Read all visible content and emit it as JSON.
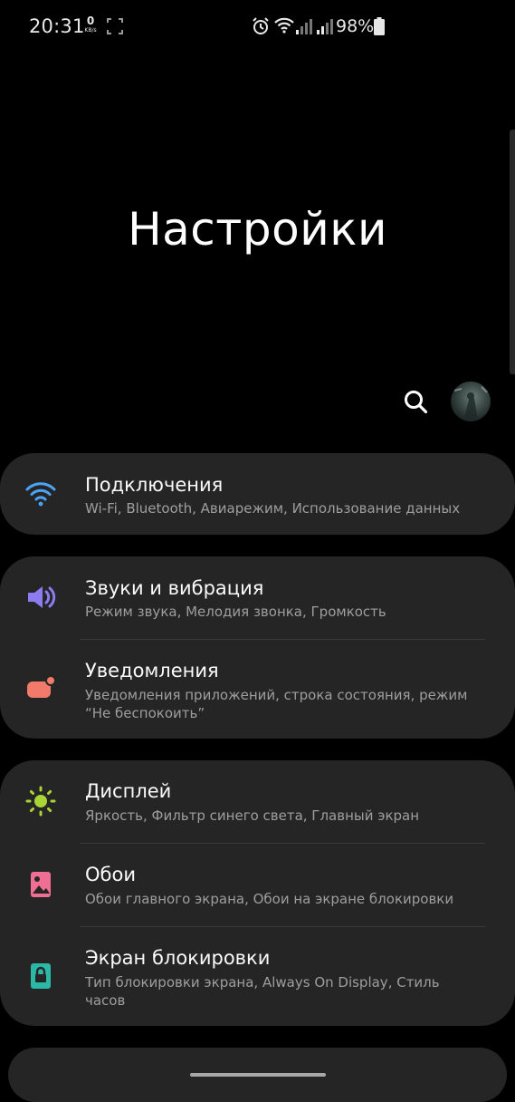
{
  "status_bar": {
    "time": "20:31",
    "net_speed_value": "0",
    "net_speed_unit": "KB/s",
    "battery_text": "98%"
  },
  "header": {
    "title": "Настройки",
    "search_icon": "search-icon",
    "avatar_icon": "user-avatar"
  },
  "groups": [
    {
      "items": [
        {
          "icon": "wifi-icon",
          "icon_color": "#4ba3f5",
          "title": "Подключения",
          "subtitle": "Wi-Fi, Bluetooth, Авиарежим, Использование данных"
        }
      ]
    },
    {
      "items": [
        {
          "icon": "volume-icon",
          "icon_color": "#8b7cf0",
          "title": "Звуки и вибрация",
          "subtitle": "Режим звука, Мелодия звонка, Громкость"
        },
        {
          "icon": "notification-icon",
          "icon_color": "#f27a6b",
          "title": "Уведомления",
          "subtitle": "Уведомления приложений, строка состояния, режим “Не беспокоить”"
        }
      ]
    },
    {
      "items": [
        {
          "icon": "brightness-icon",
          "icon_color": "#a8d435",
          "title": "Дисплей",
          "subtitle": "Яркость, Фильтр синего света, Главный экран"
        },
        {
          "icon": "wallpaper-icon",
          "icon_color": "#ee6f93",
          "title": "Обои",
          "subtitle": "Обои главного экрана, Обои на экране блокировки"
        },
        {
          "icon": "lock-icon",
          "icon_color": "#2bb8a5",
          "title": "Экран блокировки",
          "subtitle": "Тип блокировки экрана, Always On Display, Стиль часов"
        }
      ]
    }
  ]
}
